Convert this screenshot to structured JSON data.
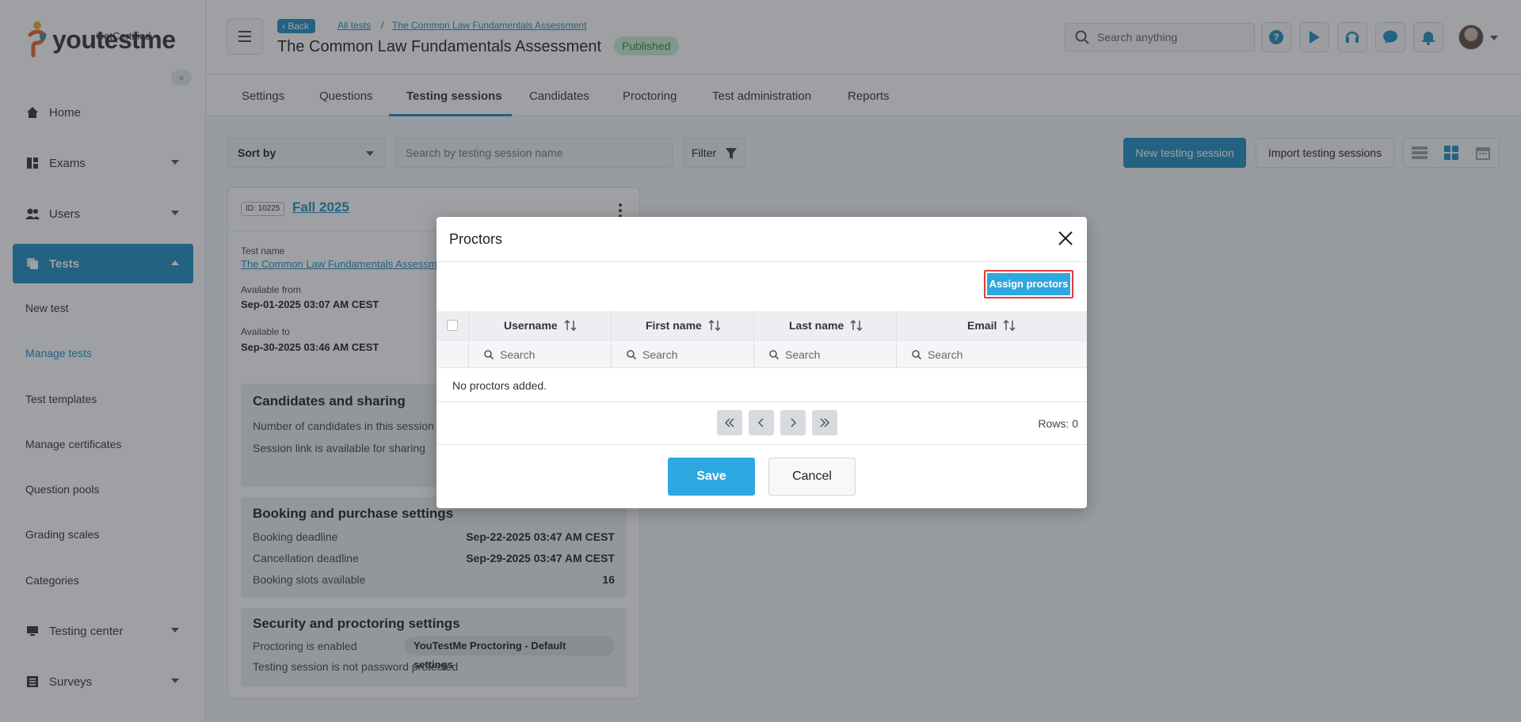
{
  "brand": {
    "name": "youtestme",
    "tagline": "GetCertified"
  },
  "sidebar": {
    "items": [
      {
        "label": "Home",
        "icon": "home-icon"
      },
      {
        "label": "Exams",
        "icon": "exams-icon"
      },
      {
        "label": "Users",
        "icon": "users-icon"
      },
      {
        "label": "Tests",
        "icon": "tests-icon"
      },
      {
        "label": "Testing center",
        "icon": "testing-center-icon"
      },
      {
        "label": "Surveys",
        "icon": "surveys-icon"
      }
    ],
    "tests_subitems": [
      "New test",
      "Manage tests",
      "Test templates",
      "Manage certificates",
      "Question pools",
      "Grading scales",
      "Categories"
    ]
  },
  "header": {
    "back_label": "Back",
    "breadcrumbs": [
      "All tests",
      "The Common Law Fundamentals Assessment"
    ],
    "breadcrumb_separator": "/",
    "title": "The Common Law Fundamentals Assessment",
    "status": "Published",
    "search_placeholder": "Search anything"
  },
  "tabs": [
    "Settings",
    "Questions",
    "Testing sessions",
    "Candidates",
    "Proctoring",
    "Test administration",
    "Reports"
  ],
  "toolbar": {
    "sort_label": "Sort by",
    "search_placeholder": "Search by testing session name",
    "filter_label": "Filter",
    "new_session_label": "New testing session",
    "import_label": "Import testing sessions"
  },
  "session_card": {
    "id_label": "ID: 10225",
    "name": "Fall 2025",
    "test_name_label": "Test name",
    "test_name": "The Common Law Fundamentals Assessment",
    "available_from_label": "Available from",
    "available_from": "Sep-01-2025 03:07 AM CEST",
    "available_to_label": "Available to",
    "available_to": "Sep-30-2025 03:46 AM CEST",
    "candidates_section": {
      "title": "Candidates and sharing",
      "row1": "Number of candidates in this session",
      "row2": "Session link is available for sharing"
    },
    "booking_section": {
      "title": "Booking and purchase settings",
      "rows": [
        {
          "label": "Booking deadline",
          "value": "Sep-22-2025 03:47 AM CEST"
        },
        {
          "label": "Cancellation deadline",
          "value": "Sep-29-2025 03:47 AM CEST"
        },
        {
          "label": "Booking slots available",
          "value": "16"
        }
      ]
    },
    "security_section": {
      "title": "Security and proctoring settings",
      "proctoring_label": "Proctoring is enabled",
      "proctoring_value": "YouTestMe Proctoring - Default settings",
      "password_label": "Testing session is not password protected"
    }
  },
  "modal": {
    "title": "Proctors",
    "assign_label": "Assign proctors",
    "columns": [
      "Username",
      "First name",
      "Last name",
      "Email"
    ],
    "filter_placeholder": "Search",
    "empty_message": "No proctors added.",
    "rows_label": "Rows: 0",
    "save_label": "Save",
    "cancel_label": "Cancel"
  },
  "colors": {
    "accent": "#1f8ebf",
    "primary_button": "#2ea8e0",
    "highlight_border": "#e23b3b",
    "published_bg": "#cdeed6"
  }
}
